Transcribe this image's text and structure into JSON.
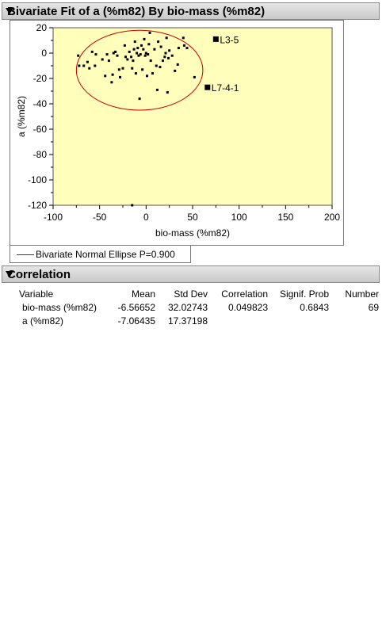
{
  "report": {
    "title": "Bivariate Fit of a (%m82) By bio-mass (%m82)",
    "legend_label": "Bivariate Normal Ellipse P=0.900"
  },
  "correlation": {
    "title": "Correlation",
    "headers": [
      "Variable",
      "Mean",
      "Std Dev",
      "Correlation",
      "Signif. Prob",
      "Number"
    ],
    "rows": [
      [
        "bio-mass (%m82)",
        "-6.56652",
        "32.02743",
        "0.049823",
        "0.6843",
        "69"
      ],
      [
        "a (%m82)",
        "-7.06435",
        "17.37198",
        "",
        "",
        ""
      ]
    ]
  },
  "colors": {
    "plot_bg": "#ffffbb",
    "point": "#000000",
    "ellipse": "#cc0000"
  },
  "chart_data": {
    "type": "scatter",
    "xlabel": "bio-mass (%m82)",
    "ylabel": "a (%m82)",
    "xlim": [
      -100,
      200
    ],
    "ylim": [
      -120,
      20
    ],
    "xticks": [
      -100,
      -50,
      0,
      50,
      100,
      150,
      200
    ],
    "yticks": [
      20,
      0,
      -20,
      -40,
      -60,
      -80,
      -100,
      -120
    ],
    "grid": false,
    "ellipse": {
      "label": "Bivariate Normal Ellipse P=0.900",
      "center": [
        -6.57,
        -7.06
      ],
      "x_range": [
        -75,
        61
      ],
      "y_range": [
        -45,
        18
      ]
    },
    "points": [
      [
        -73,
        -2
      ],
      [
        -72,
        -10
      ],
      [
        -67,
        -10
      ],
      [
        -63,
        -7
      ],
      [
        -61,
        -12
      ],
      [
        -58,
        1
      ],
      [
        -55,
        -10
      ],
      [
        -54,
        -1
      ],
      [
        -47,
        -5
      ],
      [
        -44,
        -18
      ],
      [
        -42,
        -1
      ],
      [
        -40,
        -6
      ],
      [
        -37,
        -23
      ],
      [
        -36,
        -17
      ],
      [
        -35,
        0
      ],
      [
        -33,
        1
      ],
      [
        -31,
        -2
      ],
      [
        -29,
        -13
      ],
      [
        -28,
        -19
      ],
      [
        -25,
        -12
      ],
      [
        -23,
        6
      ],
      [
        -22,
        -3
      ],
      [
        -20,
        -5
      ],
      [
        -18,
        1
      ],
      [
        -16,
        -3
      ],
      [
        -15,
        -12
      ],
      [
        -14,
        -6
      ],
      [
        -13,
        3
      ],
      [
        -12,
        9
      ],
      [
        -11,
        -16
      ],
      [
        -10,
        0
      ],
      [
        -9,
        4
      ],
      [
        -8,
        -2
      ],
      [
        -7,
        -36
      ],
      [
        -6,
        -1
      ],
      [
        -5,
        6
      ],
      [
        -4,
        -13
      ],
      [
        -3,
        3
      ],
      [
        -2,
        11
      ],
      [
        -1,
        -2
      ],
      [
        0,
        0
      ],
      [
        1,
        -18
      ],
      [
        2,
        -1
      ],
      [
        3,
        7
      ],
      [
        4,
        16
      ],
      [
        5,
        -6
      ],
      [
        7,
        -16
      ],
      [
        9,
        3
      ],
      [
        11,
        -10
      ],
      [
        12,
        -29
      ],
      [
        13,
        9
      ],
      [
        15,
        -11
      ],
      [
        16,
        5
      ],
      [
        18,
        -6
      ],
      [
        20,
        -3
      ],
      [
        21,
        0
      ],
      [
        22,
        12
      ],
      [
        23,
        -31
      ],
      [
        24,
        -4
      ],
      [
        25,
        2
      ],
      [
        28,
        -2
      ],
      [
        31,
        -14
      ],
      [
        34,
        -9
      ],
      [
        35,
        4
      ],
      [
        40,
        12
      ],
      [
        41,
        6
      ],
      [
        44,
        4
      ],
      [
        52,
        -19
      ],
      [
        -15,
        -120
      ]
    ],
    "labeled_points": [
      {
        "label": "L3-5",
        "x": 75,
        "y": 11
      },
      {
        "label": "L7-4-1",
        "x": 66,
        "y": -27
      }
    ]
  }
}
